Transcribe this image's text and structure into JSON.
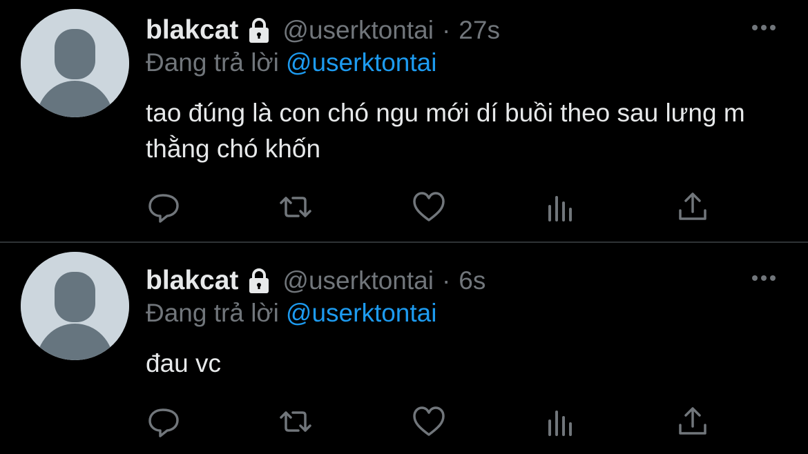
{
  "colors": {
    "background": "#000000",
    "primary_text": "#e7e9ea",
    "secondary_text": "#71767b",
    "link": "#1d9bf0",
    "divider": "#2f3336",
    "avatar_bg": "#ccd6dd",
    "avatar_figure": "#66757f"
  },
  "tweets": [
    {
      "display_name": "blakcat",
      "handle": "@userktontai",
      "separator": "·",
      "time": "27s",
      "reply_prefix": "Đang trả lời",
      "reply_target": "@userktontai",
      "text": "tao đúng là con chó ngu mới dí buồi theo sau lưng m thằng chó khốn",
      "icons": {
        "more": "more-icon",
        "verified": "lock-icon",
        "reply": "reply-icon",
        "retweet": "retweet-icon",
        "like": "heart-icon",
        "stats": "stats-icon",
        "share": "share-icon"
      }
    },
    {
      "display_name": "blakcat",
      "handle": "@userktontai",
      "separator": "·",
      "time": "6s",
      "reply_prefix": "Đang trả lời",
      "reply_target": "@userktontai",
      "text": "đau vc",
      "icons": {
        "more": "more-icon",
        "verified": "lock-icon",
        "reply": "reply-icon",
        "retweet": "retweet-icon",
        "like": "heart-icon",
        "stats": "stats-icon",
        "share": "share-icon"
      }
    }
  ]
}
